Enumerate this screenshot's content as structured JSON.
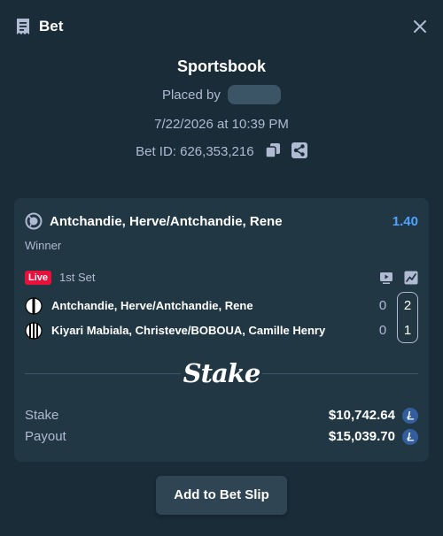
{
  "header": {
    "title": "Bet",
    "icon": "receipt-icon",
    "close_icon": "close-icon"
  },
  "bet": {
    "sportsbook_title": "Sportsbook",
    "placed_by_label": "Placed by",
    "date": "7/22/2026 at 10:39 PM",
    "bet_id": "Bet ID: 626,353,216",
    "copy_icon": "copy-icon",
    "share_icon": "share-icon"
  },
  "card": {
    "sport_icon": "tennis-ball-icon",
    "match_title": "Antchandie, Herve/Antchandie, Rene",
    "odds": "1.40",
    "market": "Winner",
    "live_badge": "Live",
    "period": "1st Set",
    "rows": [
      {
        "name": "Antchandie, Herve/Antchandie, Rene",
        "game": "0",
        "set": "2"
      },
      {
        "name": "Kiyari Mabiala, Christeve/BOBOUA, Camille Henry",
        "game": "0",
        "set": "1"
      }
    ],
    "logo_text": "Stake",
    "stake_label": "Stake",
    "stake_value": "$10,742.64",
    "payout_label": "Payout",
    "payout_value": "$15,039.70",
    "currency_icon": "litecoin-icon"
  },
  "actions": {
    "add_to_slip": "Add to Bet Slip"
  },
  "colors": {
    "background": "#1a2c38",
    "card": "#213743",
    "accent_odds": "#4da3ff",
    "live": "#e9113c",
    "muted_text": "#b1bad3",
    "button": "#2f4553",
    "coin": "#345d9d"
  }
}
